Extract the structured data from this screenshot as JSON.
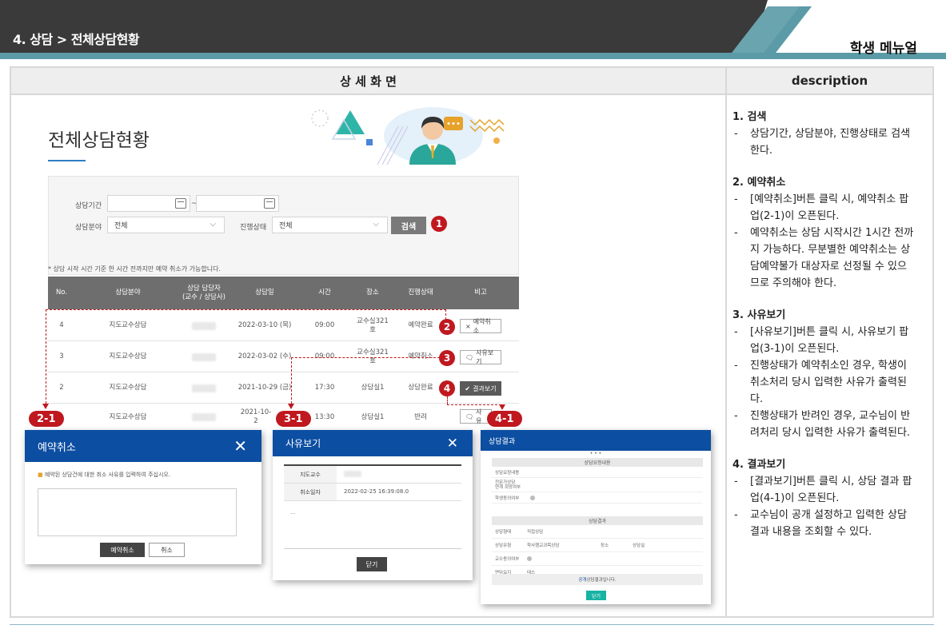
{
  "header": {
    "page_title": "4. 상담 > 전체상담현황",
    "menu_title": "학생 메뉴얼"
  },
  "columns": {
    "left_title": "상 세 화 면",
    "right_title": "description"
  },
  "screen": {
    "title": "전체상담현황",
    "search": {
      "period_label": "상담기간",
      "period_sep": "~",
      "field_label": "상담분야",
      "field_value": "전체",
      "status_label": "진행상태",
      "status_value": "전체",
      "button": "검색"
    },
    "note": "* 상담 시작 시간 기준 한 시간 전까지만 예약 취소가 가능합니다.",
    "table": {
      "headers": [
        "No.",
        "상담분야",
        "상담 담당자\n(교수 / 상담사)",
        "상담일",
        "시간",
        "장소",
        "진행상태",
        "비고"
      ],
      "rows": [
        {
          "no": "4",
          "field": "지도교수상담",
          "staff": "■■■",
          "date": "2022-03-10 (목)",
          "time": "09:00",
          "place": "교수실321\n호",
          "status": "예약완료",
          "action": "예약취소"
        },
        {
          "no": "3",
          "field": "지도교수상담",
          "staff": "■■■",
          "date": "2022-03-02 (수)",
          "time": "09:00",
          "place": "교수실321\n호",
          "status": "예약취소",
          "action": "사유보기"
        },
        {
          "no": "2",
          "field": "지도교수상담",
          "staff": "■■■",
          "date": "2021-10-29 (금)",
          "time": "17:30",
          "place": "상담실1",
          "status": "상담완료",
          "action": "결과보기"
        },
        {
          "no": "1",
          "field": "지도교수상담",
          "staff": "■■■",
          "date": "2021-10-2",
          "time": "13:30",
          "place": "상담실1",
          "status": "반려",
          "action": "사유"
        }
      ]
    },
    "badges": [
      "1",
      "2",
      "3",
      "4"
    ],
    "popup_badges": [
      "2-1",
      "3-1",
      "4-1"
    ]
  },
  "popups": {
    "cancel": {
      "title": "예약취소",
      "message": "예약된 상담건에 대한 취소 사유를 입력하여 주십시오.",
      "confirm": "예약취소",
      "cancel": "취소"
    },
    "reason": {
      "title": "사유보기",
      "rows": [
        {
          "label": "지도교수",
          "value": "■■■"
        },
        {
          "label": "취소일자",
          "value": "2022-02-25 16:39:08.0"
        }
      ],
      "body": "...",
      "close": "닫기"
    },
    "result": {
      "title": "상담결과",
      "dots": "• • •",
      "sect1": "상담요청내용",
      "rows1": [
        "상담요청내용",
        "전문가상담\n연계 희망여부",
        "학생동의여부"
      ],
      "sect2": "상담결과",
      "rows2": [
        {
          "label": "상담형태",
          "value": "직접상담"
        },
        {
          "label": "상담유형",
          "value": "학사행교과목상담",
          "label2": "장소",
          "value2": "상담실"
        },
        {
          "label": "교수동의여부",
          "value": ""
        },
        {
          "label": "면담요지",
          "value": "테스"
        }
      ],
      "footer_prefix": "공개",
      "footer": "상담결과입니다.",
      "close": "닫기"
    }
  },
  "description": {
    "sections": [
      {
        "title": "1. 검색",
        "items": [
          "상담기간, 상담분야, 진행상태로 검색한다."
        ]
      },
      {
        "title": "2. 예약취소",
        "items": [
          "[예약취소]버튼 클릭 시, 예약취소 팝업(2-1)이 오픈된다.",
          "예약취소는 상담 시작시간 1시간 전까지 가능하다. 무분별한 예약취소는 상담예약불가 대상자로 선정될 수 있으므로 주의해야 한다."
        ]
      },
      {
        "title": "3. 사유보기",
        "items": [
          "[사유보기]버튼 클릭 시, 사유보기 팝업(3-1)이 오픈된다.",
          "진행상태가 예약취소인 경우, 학생이 취소처리 당시 입력한 사유가 출력된다.",
          "진행상태가 반려인 경우, 교수님이 반려처리 당시 입력한 사유가 출력된다."
        ]
      },
      {
        "title": "4. 결과보기",
        "items": [
          "[결과보기]버튼 클릭 시, 상담 결과 팝업(4-1)이 오픈된다.",
          "교수님이 공개 설정하고 입력한 상담결과 내용을 조회할 수 있다."
        ]
      }
    ]
  },
  "colors": {
    "accent_blue": "#0c4ea2",
    "badge_red": "#c0181f",
    "header_dark": "#3a3a3a",
    "header_teal": "#5b9ba7",
    "result_green": "#17b3a3"
  }
}
